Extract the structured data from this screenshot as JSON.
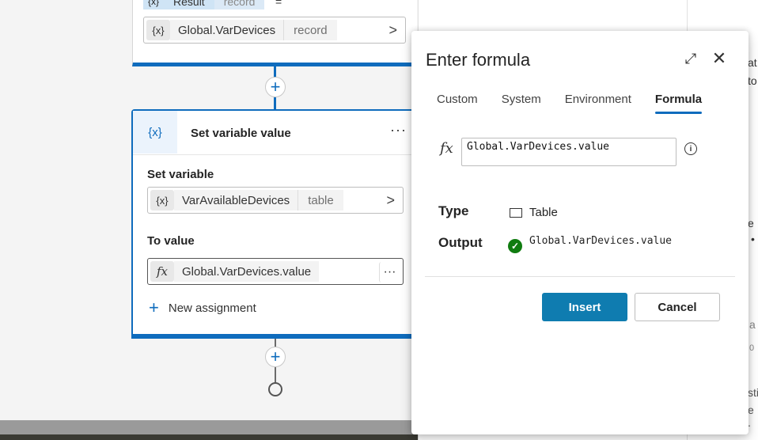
{
  "flow": {
    "top_card": {
      "result_icon": "{x}",
      "result_label": "Result",
      "result_type": "record",
      "result_eq": "=",
      "value_icon": "{x}",
      "value_text": "Global.VarDevices",
      "value_type": "record",
      "chevron": ">"
    },
    "add_node": "+",
    "main_card": {
      "header_icon": "{x}",
      "title": "Set variable value",
      "more": "···",
      "set_variable_label": "Set variable",
      "variable_icon": "{x}",
      "variable_name": "VarAvailableDevices",
      "variable_type": "table",
      "chevron": ">",
      "to_value_label": "To value",
      "value_icon": "fx",
      "value_text": "Global.VarDevices.value",
      "value_more": "···",
      "new_assignment_plus": "+",
      "new_assignment_label": "New assignment"
    }
  },
  "right_strip": {
    "frag1": "at",
    "frag2": "to",
    "frag3": "e",
    "frag4": "•",
    "frag5": "a",
    "frag6": "0",
    "frag7": "sti",
    "frag8": "e ."
  },
  "dialog": {
    "title": "Enter formula",
    "expand_icon": "⤢",
    "close_icon": "✕",
    "tabs": [
      {
        "label": "Custom"
      },
      {
        "label": "System"
      },
      {
        "label": "Environment"
      },
      {
        "label": "Formula"
      }
    ],
    "active_tab": "Formula",
    "fx_label": "fx",
    "formula_value": "Global.VarDevices.value",
    "info_icon": "i",
    "type_label": "Type",
    "type_value": "Table",
    "output_label": "Output",
    "output_check": "✓",
    "output_value": "Global.VarDevices.value",
    "insert_label": "Insert",
    "cancel_label": "Cancel"
  },
  "colors": {
    "accent": "#0f6cbd",
    "primary_button": "#0f7cb0",
    "success": "#107c10"
  }
}
